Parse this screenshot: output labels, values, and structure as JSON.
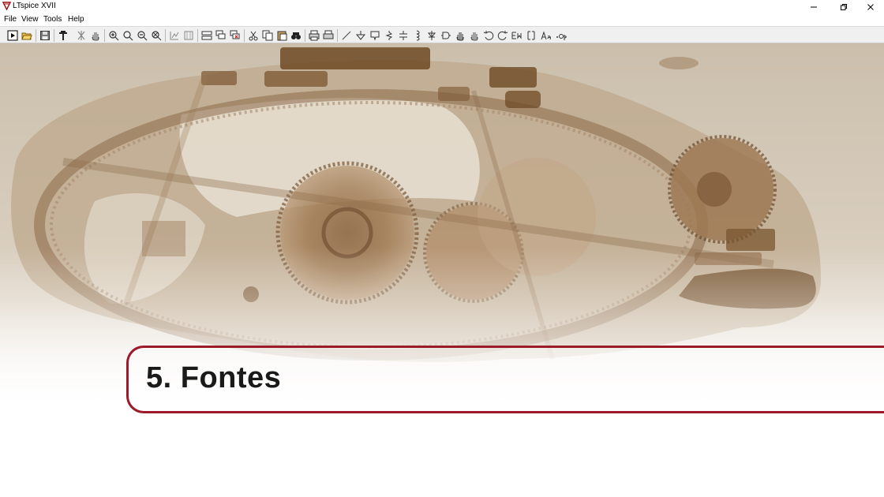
{
  "window": {
    "title": "LTspice XVII",
    "icon": "ltspice-app-icon"
  },
  "menu": {
    "items": [
      {
        "label": "File",
        "name": "menu-file"
      },
      {
        "label": "View",
        "name": "menu-view"
      },
      {
        "label": "Tools",
        "name": "menu-tools"
      },
      {
        "label": "Help",
        "name": "menu-help"
      }
    ]
  },
  "toolbar": {
    "icons": [
      "run-icon",
      "open-icon",
      "save-icon",
      "control-panel-icon",
      "halt-icon",
      "pan-icon",
      "zoom-in-icon",
      "zoom-area-icon",
      "zoom-out-icon",
      "zoom-fit-icon",
      "autorange-icon",
      "grid-icon",
      "tile-icon",
      "cascade-icon",
      "close-icon",
      "cut-icon",
      "copy-icon",
      "paste-icon",
      "find-icon",
      "print-icon",
      "print-preview-icon",
      "wire-icon",
      "ground-icon",
      "label-icon",
      "resistor-icon",
      "capacitor-icon",
      "inductor-icon",
      "diode-icon",
      "component-icon",
      "move-icon",
      "drag-icon",
      "undo-icon",
      "redo-icon",
      "rotate-icon",
      "mirror-icon",
      "text-icon",
      "spice-directive-icon"
    ]
  },
  "document": {
    "chapter_title": "5. Fontes",
    "background": "antikythera-mechanism-sepia-image"
  },
  "colors": {
    "accent": "#9b1b2a",
    "sepia": "#7a5a3a"
  }
}
